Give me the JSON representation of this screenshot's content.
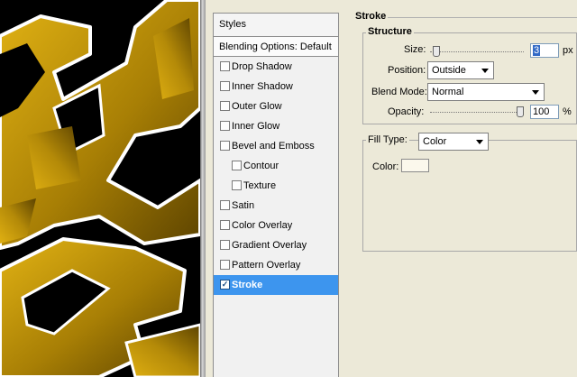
{
  "styles_panel": {
    "header": "Styles",
    "blending_options": "Blending Options: Default",
    "items": [
      {
        "label": "Drop Shadow",
        "checked": false
      },
      {
        "label": "Inner Shadow",
        "checked": false
      },
      {
        "label": "Outer Glow",
        "checked": false
      },
      {
        "label": "Inner Glow",
        "checked": false
      },
      {
        "label": "Bevel and Emboss",
        "checked": false
      },
      {
        "label": "Contour",
        "checked": false
      },
      {
        "label": "Texture",
        "checked": false
      },
      {
        "label": "Satin",
        "checked": false
      },
      {
        "label": "Color Overlay",
        "checked": false
      },
      {
        "label": "Gradient Overlay",
        "checked": false
      },
      {
        "label": "Pattern Overlay",
        "checked": false
      },
      {
        "label": "Stroke",
        "checked": true
      }
    ]
  },
  "stroke": {
    "title": "Stroke",
    "structure_title": "Structure",
    "size": {
      "label": "Size:",
      "value": "3",
      "unit": "px",
      "level": 0.03
    },
    "position": {
      "label": "Position:",
      "value": "Outside"
    },
    "blend_mode": {
      "label": "Blend Mode:",
      "value": "Normal"
    },
    "opacity": {
      "label": "Opacity:",
      "value": "100",
      "unit": "%",
      "level": 1.0
    },
    "fill_type": {
      "label": "Fill Type:",
      "value": "Color"
    },
    "color": {
      "label": "Color:",
      "value": "#fbf8ec"
    }
  },
  "art": {
    "gold_light": "#d8a80c",
    "gold_mid": "#a57f06",
    "gold_dark": "#5c4300",
    "outline": "#ffffff",
    "background": "#000000"
  }
}
